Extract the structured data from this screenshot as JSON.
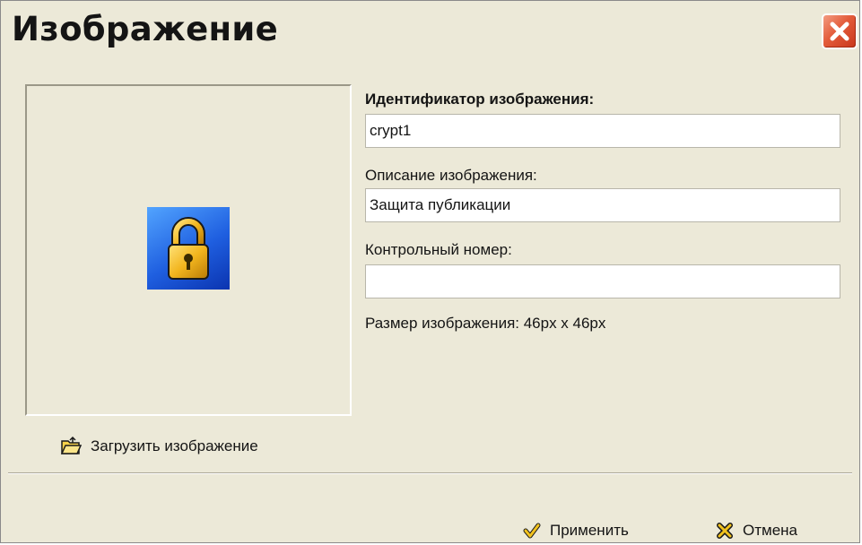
{
  "window": {
    "title": "Изображение",
    "close_icon": "close-icon"
  },
  "preview": {
    "image_icon": "padlock-icon",
    "load_label": "Загрузить изображение",
    "load_icon": "open-folder-icon"
  },
  "form": {
    "id_label": "Идентификатор изображения:",
    "id_value": "crypt1",
    "description_label": "Описание изображения:",
    "description_value": "Защита публикации",
    "control_number_label": "Контрольный номер:",
    "control_number_value": "",
    "size_text": "Размер изображения: 46px x 46px"
  },
  "buttons": {
    "apply_label": "Применить",
    "apply_icon": "checkmark-icon",
    "cancel_label": "Отмена",
    "cancel_icon": "cross-icon"
  },
  "colors": {
    "dialog_bg": "#ece9d8",
    "close_button": "#e35b3a",
    "image_bg": "#1f5fe0",
    "lock_gold": "#f2b51e"
  }
}
